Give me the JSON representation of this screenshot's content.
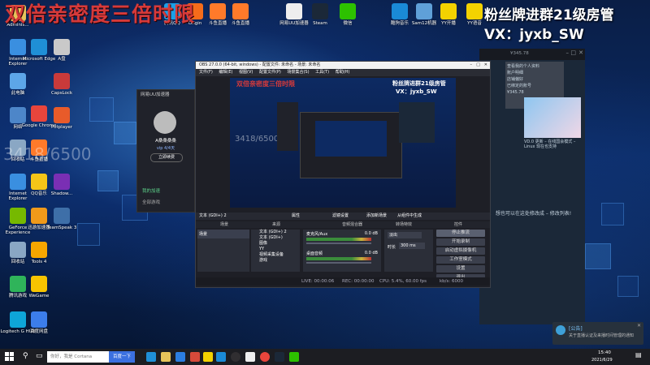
{
  "overlay": {
    "red_title": "双倍亲密度三倍时限",
    "right_line1": "粉丝牌进群21级房管",
    "right_line2": "VX：jyxb_SW",
    "counter": "3418/6500"
  },
  "desktop_left": [
    {
      "label": "Adminis..."
    },
    {
      "label": "Internet Explorer"
    },
    {
      "label": "此电脑"
    },
    {
      "label": "网络"
    },
    {
      "label": "回收站"
    },
    {
      "label": "Internet Explorer"
    },
    {
      "label": "GeForce Experience"
    },
    {
      "label": "回收站"
    },
    {
      "label": "腾讯游戏"
    },
    {
      "label": "Logitech G HUB"
    }
  ],
  "desktop_col2": [
    {
      "label": "Microsoft Edge"
    },
    {
      "label": "Google Chrome"
    },
    {
      "label": "斗鱼直播"
    },
    {
      "label": "QQ音乐"
    },
    {
      "label": "迅游加速器"
    },
    {
      "label": "Tools 4"
    },
    {
      "label": "WeGame"
    },
    {
      "label": "百度网盘"
    }
  ],
  "desktop_col3": [
    {
      "label": "A盘"
    },
    {
      "label": "CapsLock"
    },
    {
      "label": "Potplayer"
    },
    {
      "label": "Shadow..."
    },
    {
      "label": "TeamSpeak 3"
    }
  ],
  "top_icons": [
    {
      "label": "腾讯QQ"
    },
    {
      "label": "Origin"
    },
    {
      "label": "斗鱼直播"
    },
    {
      "label": "斗鱼直播"
    },
    {
      "label": "网易UU加速器"
    },
    {
      "label": "Steam"
    },
    {
      "label": "微信"
    },
    {
      "label": "酷狗音乐"
    },
    {
      "label": "Sam12机器"
    },
    {
      "label": "YY开播"
    },
    {
      "label": "YY语音"
    }
  ],
  "obs": {
    "title": "OBS 27.0.0 (64-bit, windows) - 配置文件: 未命名 - 场景: 未命名",
    "menu": [
      "文件(F)",
      "编辑(E)",
      "视图(V)",
      "配置文件(P)",
      "场景集合(S)",
      "工具(T)",
      "帮助(H)"
    ],
    "source_bar": "文本 (GDI+) 2",
    "source_tabs": [
      "属性",
      "滤镜设置",
      "添加新场景",
      "从组件中生成"
    ],
    "docks": {
      "scenes": "场景",
      "sources": "来源",
      "mixer": "音频混合器",
      "transitions": "转场特效",
      "controls": "控件"
    },
    "scene_items": [
      "场景"
    ],
    "source_items": [
      "文本 (GDI+) 2",
      "文本 (GDI+)",
      "图像",
      "YY",
      "视频采集设备",
      "游戏"
    ],
    "mixer": [
      {
        "name": "麦克风/Aux",
        "db": "0.0 dB"
      },
      {
        "name": "桌面音频",
        "db": "0.0 dB"
      }
    ],
    "transition": {
      "type": "淡出",
      "duration_label": "时长",
      "duration": "300 ms"
    },
    "controls": [
      "停止推流",
      "开始录制",
      "启动虚拟摄像机",
      "工作室模式",
      "设置",
      "退出"
    ],
    "status": {
      "live": "LIVE: 00:00:06",
      "rec": "REC: 00:00:00",
      "cpu": "CPU: 5.4%, 60.00 fps",
      "kbps": "kb/s: 6000"
    }
  },
  "qq_panel": {
    "title": "网易UU加速器",
    "user": "A桑桑桑桑",
    "vip": "vip 4/4天",
    "renew": "立即续费",
    "menu": [
      "我的加速",
      "全部游戏"
    ]
  },
  "steam": {
    "user": "¥345.78",
    "profile_rows": [
      "查看我的个人资料",
      "账户明细",
      "店铺偏好",
      "已绑定的账号",
      "¥345.78"
    ],
    "news": "VD.0 更新 – 在线国会模式 – Linux 现在也支持",
    "chat_hint": "内容。 想也可以在这处修改成 – 修改列表!"
  },
  "notification": {
    "title": "[公告]",
    "body": "关于直播认证及来播时间管理的通知"
  },
  "taskbar": {
    "search_placeholder": "你好，我是 Cortana",
    "search_button": "百度一下",
    "time": "15:40",
    "date": "2021/6/29"
  }
}
